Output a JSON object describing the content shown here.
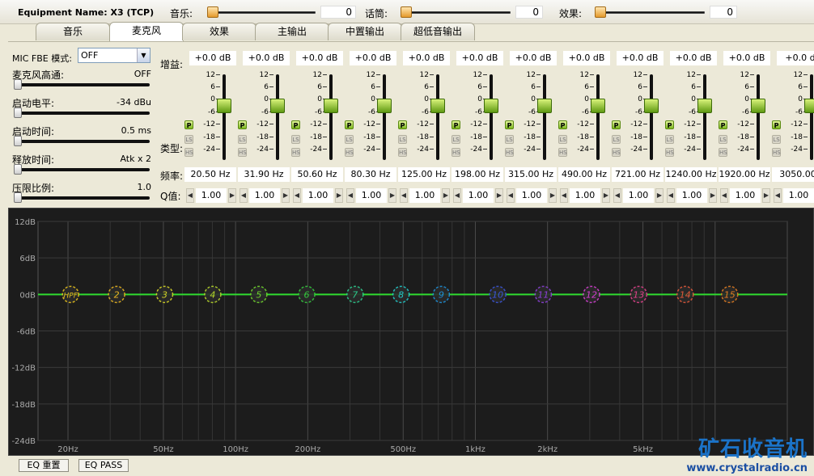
{
  "equipment": {
    "label": "Equipment Name: X3 (TCP)"
  },
  "mixers": [
    {
      "label": "音乐:",
      "value": "0"
    },
    {
      "label": "话筒:",
      "value": "0"
    },
    {
      "label": "效果:",
      "value": "0"
    }
  ],
  "tabs": [
    {
      "label": "音乐",
      "active": false
    },
    {
      "label": "麦克风",
      "active": true
    },
    {
      "label": "效果",
      "active": false
    },
    {
      "label": "主输出",
      "active": false
    },
    {
      "label": "中置输出",
      "active": false
    },
    {
      "label": "超低音输出",
      "active": false
    }
  ],
  "left": {
    "fbe_label": "MIC FBE 模式:",
    "fbe_value": "OFF",
    "controls": [
      {
        "name": "麦克风高通:",
        "value": "OFF",
        "level": 0.0
      },
      {
        "name": "启动电平:",
        "value": "-34 dBu",
        "level": 0.0
      },
      {
        "name": "启动时间:",
        "value": "0.5 ms",
        "level": 0.0
      },
      {
        "name": "释放时间:",
        "value": "Atk x 2",
        "level": 0.0
      },
      {
        "name": "压限比例:",
        "value": "1.0",
        "level": 0.0
      }
    ]
  },
  "eq_labels": {
    "gain": "增益:",
    "type": "类型:",
    "freq": "频率:",
    "q": "Q值:"
  },
  "scale_labels": [
    "12",
    "6",
    "0",
    "-6",
    "-12",
    "-18",
    "-24"
  ],
  "type_buttons": {
    "p": "P",
    "ls": "LS",
    "hs": "HS"
  },
  "bands": [
    {
      "gain": "+0.0 dB",
      "freq": "20.50 Hz",
      "q": "1.00"
    },
    {
      "gain": "+0.0 dB",
      "freq": "31.90 Hz",
      "q": "1.00"
    },
    {
      "gain": "+0.0 dB",
      "freq": "50.60 Hz",
      "q": "1.00"
    },
    {
      "gain": "+0.0 dB",
      "freq": "80.30 Hz",
      "q": "1.00"
    },
    {
      "gain": "+0.0 dB",
      "freq": "125.00 Hz",
      "q": "1.00"
    },
    {
      "gain": "+0.0 dB",
      "freq": "198.00 Hz",
      "q": "1.00"
    },
    {
      "gain": "+0.0 dB",
      "freq": "315.00 Hz",
      "q": "1.00"
    },
    {
      "gain": "+0.0 dB",
      "freq": "490.00 Hz",
      "q": "1.00"
    },
    {
      "gain": "+0.0 dB",
      "freq": "721.00 Hz",
      "q": "1.00"
    },
    {
      "gain": "+0.0 dB",
      "freq": "1240.00 Hz",
      "q": "1.00"
    },
    {
      "gain": "+0.0 dB",
      "freq": "1920.00 Hz",
      "q": "1.00"
    },
    {
      "gain": "+0.0 d",
      "freq": "3050.00",
      "q": "1.00"
    }
  ],
  "graph": {
    "y_labels": [
      "12dB",
      "6dB",
      "0dB",
      "-6dB",
      "-12dB",
      "-18dB",
      "-24dB"
    ],
    "x_labels": [
      "20Hz",
      "50Hz",
      "100Hz",
      "200Hz",
      "500Hz",
      "1kHz",
      "2kHz",
      "5kHz"
    ],
    "markers": [
      {
        "label": "HPF",
        "freq": 20.5,
        "color": "#e8c21c"
      },
      {
        "label": "2",
        "freq": 31.9,
        "color": "#e6b422"
      },
      {
        "label": "3",
        "freq": 50.6,
        "color": "#d4d428"
      },
      {
        "label": "4",
        "freq": 80.3,
        "color": "#b6d62a"
      },
      {
        "label": "5",
        "freq": 125,
        "color": "#6fd42c"
      },
      {
        "label": "6",
        "freq": 198,
        "color": "#35c93e"
      },
      {
        "label": "7",
        "freq": 315,
        "color": "#2cc98c"
      },
      {
        "label": "8",
        "freq": 490,
        "color": "#22c8c8"
      },
      {
        "label": "9",
        "freq": 721,
        "color": "#1e8fd6"
      },
      {
        "label": "10",
        "freq": 1240,
        "color": "#3b55d8"
      },
      {
        "label": "11",
        "freq": 1920,
        "color": "#8a3fd6"
      },
      {
        "label": "12",
        "freq": 3050,
        "color": "#d23fd0"
      },
      {
        "label": "13",
        "freq": 4800,
        "color": "#e0408a"
      },
      {
        "label": "14",
        "freq": 7500,
        "color": "#e0583a"
      },
      {
        "label": "15",
        "freq": 11500,
        "color": "#e07c22"
      }
    ],
    "line_color": "#2fdc2f"
  },
  "buttons": {
    "reset": "EQ 重置",
    "pass": "EQ PASS"
  },
  "watermark": {
    "cn": "矿石收音机",
    "url": "www.crystalradio.cn"
  }
}
